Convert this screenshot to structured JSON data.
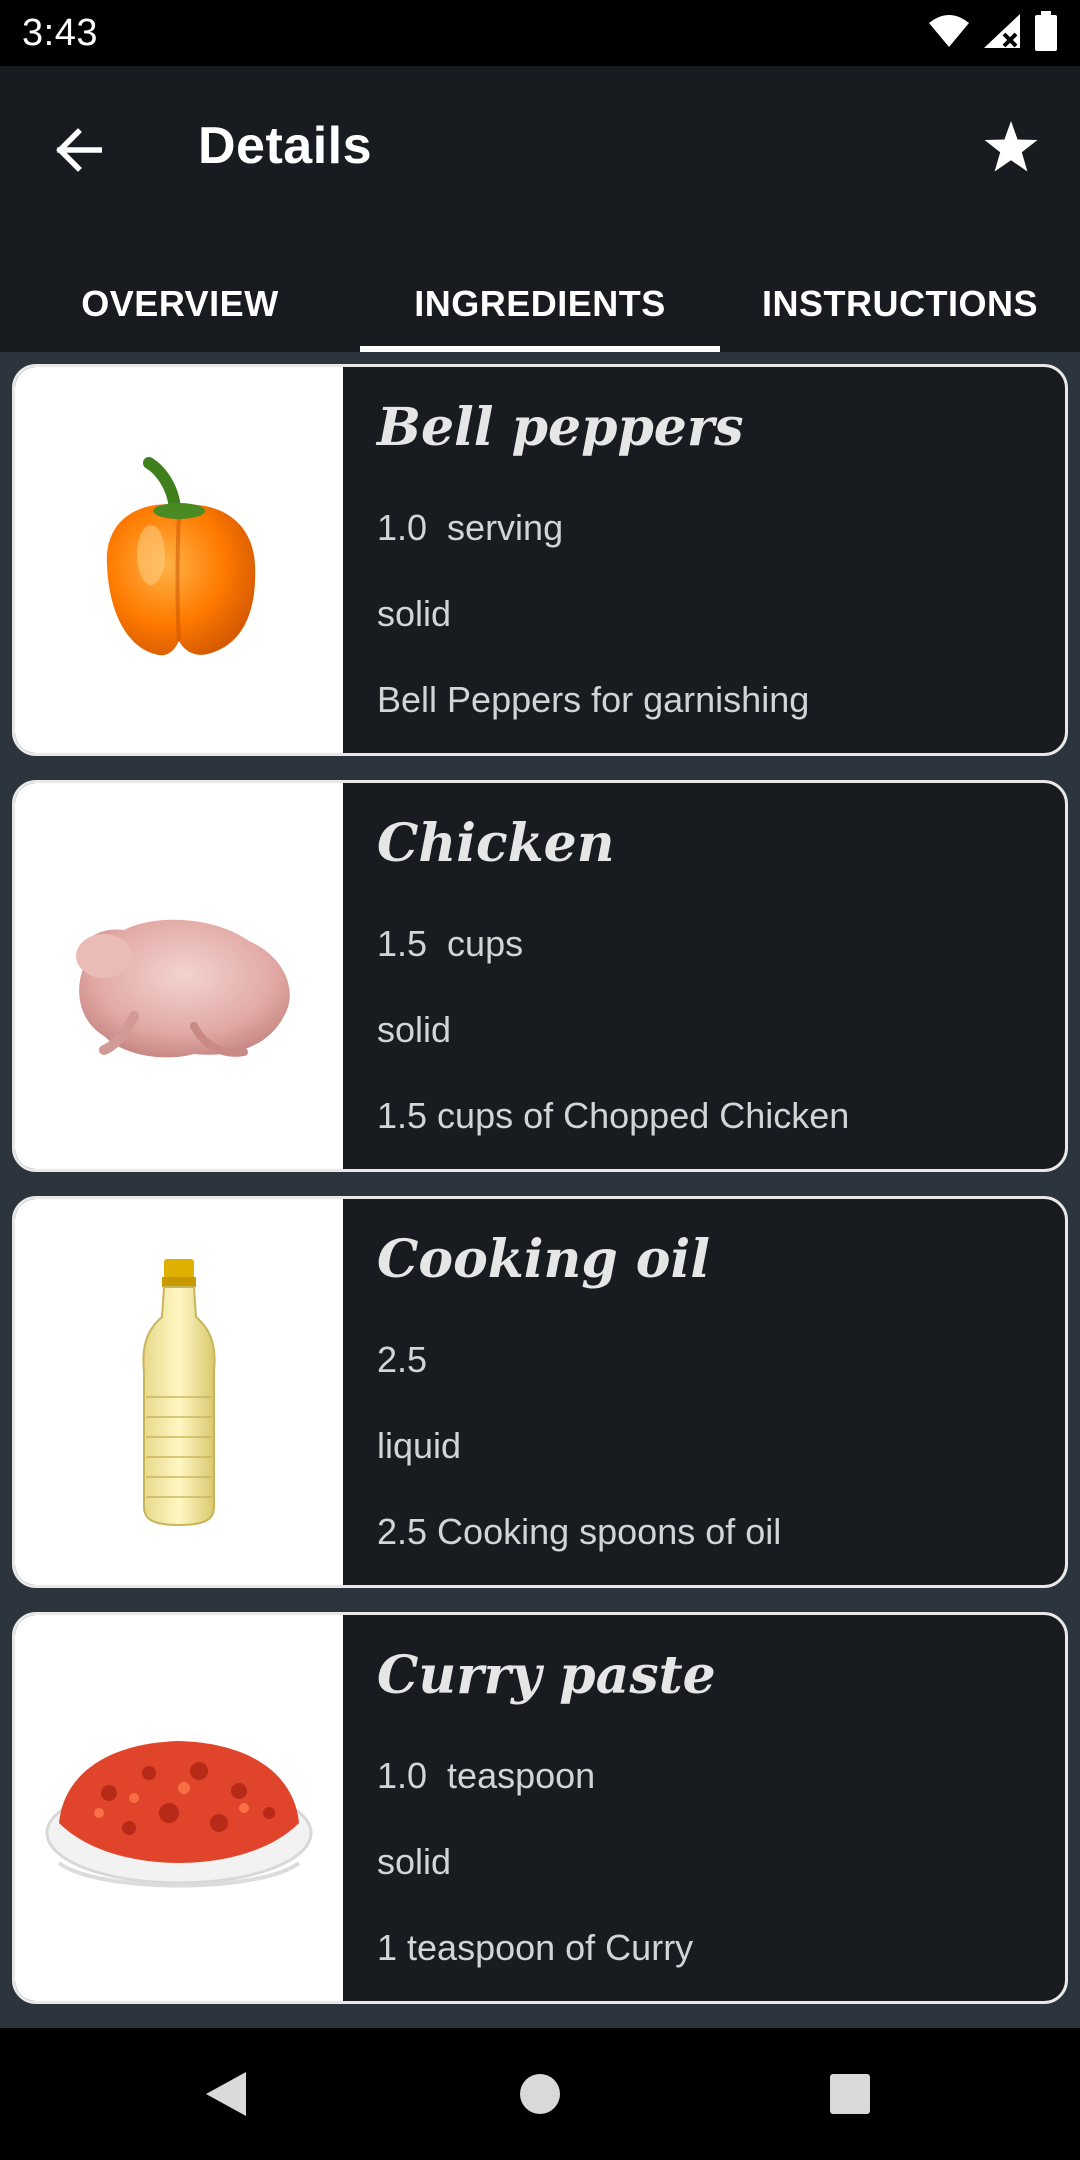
{
  "status_bar": {
    "time": "3:43"
  },
  "app_bar": {
    "title": "Details"
  },
  "tabs": [
    {
      "label": "OVERVIEW",
      "active": false
    },
    {
      "label": "INGREDIENTS",
      "active": true
    },
    {
      "label": "INSTRUCTIONS",
      "active": false
    }
  ],
  "ingredients": [
    {
      "name": "Bell peppers",
      "quantity": "1.0  serving",
      "state": "solid",
      "description": "Bell Peppers for garnishing",
      "image": "bell-pepper-image"
    },
    {
      "name": "Chicken",
      "quantity": "1.5  cups",
      "state": "solid",
      "description": "1.5 cups of Chopped Chicken",
      "image": "raw-chicken-image"
    },
    {
      "name": "Cooking oil",
      "quantity": "2.5",
      "state": "liquid",
      "description": "2.5 Cooking spoons of oil",
      "image": "oil-bottle-image"
    },
    {
      "name": "Curry paste",
      "quantity": "1.0  teaspoon",
      "state": "solid",
      "description": "1 teaspoon of Curry",
      "image": "curry-paste-image"
    }
  ],
  "colors": {
    "app_bar": "#181c21",
    "list_bg": "#2c353d",
    "card_border": "#e8e8e8",
    "text": "#d2d4d6"
  }
}
